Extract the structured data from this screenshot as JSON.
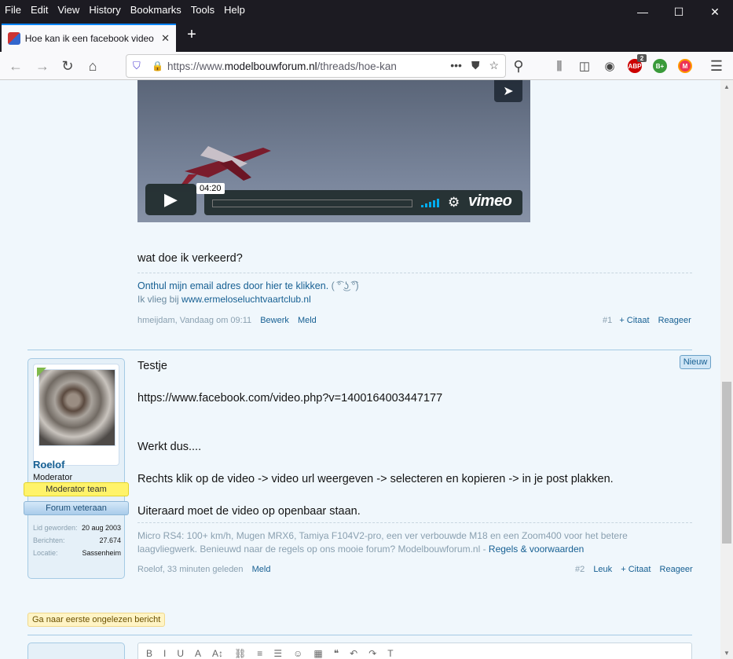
{
  "menubar": [
    "File",
    "Edit",
    "View",
    "History",
    "Bookmarks",
    "Tools",
    "Help"
  ],
  "window_controls": [
    "—",
    "☐",
    "✕"
  ],
  "tab": {
    "title": "Hoe kan ik een facebook video",
    "close": "✕"
  },
  "newtab": "+",
  "nav": {
    "back": "←",
    "forward": "→",
    "reload": "↻",
    "home": "⌂"
  },
  "url": {
    "prefix": "https://www.",
    "domain": "modelbouwforum.nl",
    "path": "/threads/hoe-kan",
    "more": "•••"
  },
  "extensions": {
    "abp_badge": "2",
    "abp": "ABP",
    "b": "B+",
    "m": "M"
  },
  "video": {
    "timestamp": "04:20",
    "brand": "vimeo"
  },
  "post1": {
    "text": "wat doe ik verkeerd?",
    "sig_email_pre": "Onthul mijn email adres door hier te klikken.",
    "sig_face": " ( ͡° ͜ʖ ͡°)",
    "sig_club_pre": "Ik vlieg bij ",
    "sig_club_link": "www.ermeloseluchtvaartclub.nl",
    "meta_author": "hmeijdam, Vandaag om 09:11",
    "edit": "Bewerk",
    "report": "Meld",
    "number": "#1",
    "quote": "+ Citaat",
    "reply": "Reageer"
  },
  "post2": {
    "username": "Roelof",
    "usertitle": "Moderator",
    "banner_mod": "Moderator team",
    "banner_vet": "Forum veteraan",
    "stats": [
      {
        "key": "Lid geworden:",
        "value": "20 aug 2003"
      },
      {
        "key": "Berichten:",
        "value": "27.674"
      },
      {
        "key": "Locatie:",
        "value": "Sassenheim"
      }
    ],
    "line1": "Testje",
    "link": "https://www.facebook.com/video.php?v=1400164003447177",
    "line2": "Werkt dus....",
    "line3": "Rechts klik op de video -> video url weergeven -> selecteren en kopieren -> in je post plakken.",
    "line4": "Uiteraard moet de video op openbaar staan.",
    "sig1": "Micro RS4: 100+ km/h, Mugen MRX6, Tamiya F104V2-pro, een ver verbouwde M18 en een Zoom400 voor het betere",
    "sig2_pre": "laagvliegwerk. Benieuwd naar de regels op ons mooie forum? Modelbouwforum.nl - ",
    "sig2_link": "Regels & voorwaarden",
    "meta_author": "Roelof, 33 minuten geleden",
    "report": "Meld",
    "number": "#2",
    "like": "Leuk",
    "quote": "+ Citaat",
    "reply": "Reageer",
    "new_badge": "Nieuw"
  },
  "unread_button": "Ga naar eerste ongelezen bericht",
  "editor_tools": [
    "B",
    "I",
    "U",
    "A",
    "A↕",
    "⛓",
    "≡",
    "☰",
    "☺",
    "▦",
    "❝",
    "↶",
    "↷",
    "T"
  ]
}
